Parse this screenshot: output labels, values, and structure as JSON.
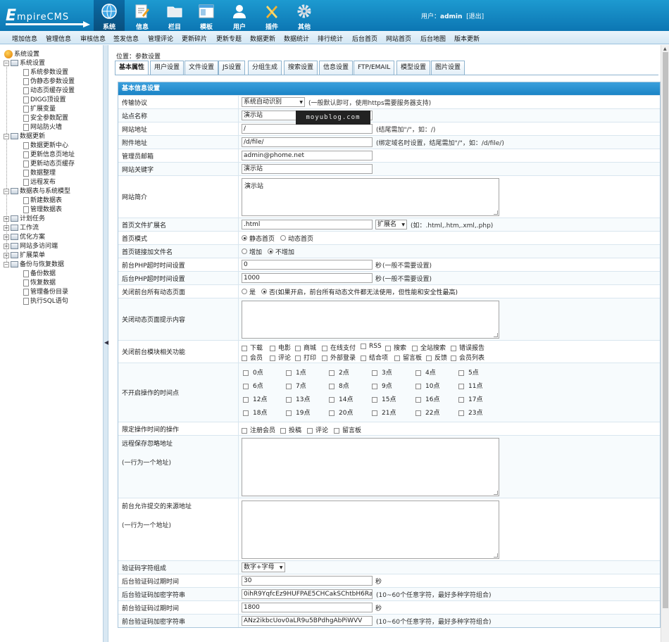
{
  "header": {
    "logo_text": "EmpireCMS",
    "nav": [
      {
        "label": "系统",
        "icon": "globe-icon",
        "active": true
      },
      {
        "label": "信息",
        "icon": "edit-icon"
      },
      {
        "label": "栏目",
        "icon": "folder-icon"
      },
      {
        "label": "模板",
        "icon": "template-icon"
      },
      {
        "label": "用户",
        "icon": "user-icon"
      },
      {
        "label": "插件",
        "icon": "tools-icon"
      },
      {
        "label": "其他",
        "icon": "gear-icon"
      }
    ],
    "user_prefix": "用户：",
    "username": "admin",
    "logout": "[退出]"
  },
  "menubar": [
    "增加信息",
    "管理信息",
    "审核信息",
    "签发信息",
    "管理评论",
    "更新碎片",
    "更新专题",
    "数据更新",
    "数据统计",
    "排行统计",
    "后台首页",
    "网站首页",
    "后台地图",
    "版本更新"
  ],
  "sidebar": {
    "root": "系统设置",
    "groups": [
      {
        "label": "系统设置",
        "items": [
          "系统参数设置",
          "伪静态参数设置",
          "动态页缓存设置",
          "DIGG顶设置",
          "扩展变量",
          "安全参数配置",
          "网站防火墙"
        ]
      },
      {
        "label": "数据更新",
        "items": [
          "数据更新中心",
          "更新信息页地址",
          "更新动态页缓存",
          "数据整理",
          "远程发布"
        ]
      },
      {
        "label": "数据表与系统模型",
        "items": [
          "新建数据表",
          "管理数据表"
        ]
      },
      {
        "label": "计划任务",
        "items": []
      },
      {
        "label": "工作流",
        "items": []
      },
      {
        "label": "优化方案",
        "items": []
      },
      {
        "label": "网站多访问端",
        "items": []
      },
      {
        "label": "扩展菜单",
        "items": []
      },
      {
        "label": "备份与恢复数据",
        "items": [
          "备份数据",
          "恢复数据",
          "管理备份目录",
          "执行SQL语句"
        ]
      }
    ],
    "collapse_arrow": "◀"
  },
  "main": {
    "location": "位置：参数设置",
    "tabs": [
      "基本属性",
      "用户设置",
      "文件设置",
      "JS设置",
      "分组生成",
      "搜索设置",
      "信息设置",
      "FTP/EMAIL",
      "模型设置",
      "图片设置"
    ],
    "section_title": "基本信息设置",
    "f": {
      "protocol": {
        "label": "传输协议",
        "value": "系统自动识别",
        "hint": "(一般默认即可，使用https需要服务器支持)"
      },
      "sitename": {
        "label": "站点名称",
        "value": "演示站"
      },
      "siteurl": {
        "label": "网站地址",
        "value": "/",
        "hint": "(结尾需加\"/\"，如：/)"
      },
      "fileurl": {
        "label": "附件地址",
        "value": "/d/file/",
        "hint": "(绑定域名时设置，结尾需加\"/\"，如：/d/file/)"
      },
      "email": {
        "label": "管理员邮箱",
        "value": "admin@phome.net"
      },
      "keywords": {
        "label": "网站关键字",
        "value": "演示站"
      },
      "intro": {
        "label": "网站简介",
        "value": "演示站"
      },
      "indexext": {
        "label": "首页文件扩展名",
        "value": ".html",
        "select": "扩展名",
        "hint": "(如：.html,.htm,.xml,.php)"
      },
      "indexmode": {
        "label": "首页模式",
        "opt1": "静态首页",
        "opt2": "动态首页"
      },
      "indexlink": {
        "label": "首页链接加文件名",
        "opt1": "增加",
        "opt2": "不增加"
      },
      "phptimeout": {
        "label": "前台PHP超时时间设置",
        "value": "0",
        "unit": "秒",
        "hint": "(一般不需要设置)"
      },
      "adminphptimeout": {
        "label": "后台PHP超时时间设置",
        "value": "1000",
        "unit": "秒",
        "hint": "(一般不需要设置)"
      },
      "closedynamic": {
        "label": "关闭前台所有动态页面",
        "opt1": "是",
        "opt2": "否",
        "hint": "(如果开启，前台所有动态文件都无法使用，但性能和安全性最高)"
      },
      "closetip": {
        "label": "关闭动态页面提示内容"
      },
      "closemods": {
        "label": "关闭前台模块相关功能",
        "row1": [
          "下载",
          "电影",
          "商城",
          "在线支付",
          "RSS",
          "搜索",
          "全站搜索",
          "错误报告"
        ],
        "row2": [
          "会员",
          "评论",
          "打印",
          "外部登录",
          "结合项",
          "留言板",
          "反馈",
          "会员列表"
        ]
      },
      "hours": {
        "label": "不开启操作的时间点",
        "values": [
          "0点",
          "1点",
          "2点",
          "3点",
          "4点",
          "5点",
          "6点",
          "7点",
          "8点",
          "9点",
          "10点",
          "11点",
          "12点",
          "13点",
          "14点",
          "15点",
          "16点",
          "17点",
          "18点",
          "19点",
          "20点",
          "21点",
          "22点",
          "23点"
        ]
      },
      "limitops": {
        "label": "限定操作时间的操作",
        "items": [
          "注册会员",
          "投稿",
          "评论",
          "留言板"
        ]
      },
      "remoteignore": {
        "label": "远程保存忽略地址",
        "sub": "(一行为一个地址)"
      },
      "allowsource": {
        "label": "前台允许提交的来源地址",
        "sub": "(一行为一个地址)"
      },
      "captchachars": {
        "label": "验证码字符组成",
        "value": "数字+字母"
      },
      "admincaptchatime": {
        "label": "后台验证码过期时间",
        "value": "30",
        "unit": "秒"
      },
      "admincaptchakey": {
        "label": "后台验证码加密字符串",
        "value": "0ihR9YqfcEz9HUFPAE5CHCakSChtbH6RaeRy",
        "hint": "(10~60个任意字符，最好多种字符组合)"
      },
      "captchatime": {
        "label": "前台验证码过期时间",
        "value": "1800",
        "unit": "秒"
      },
      "captchakey": {
        "label": "前台验证码加密字符串",
        "value": "ANz2ikbcUov0aLR9u5BPdhgAbPiWVV",
        "hint": "(10~60个任意字符，最好多种字符组合)"
      }
    }
  },
  "watermark": "moyublog.com"
}
